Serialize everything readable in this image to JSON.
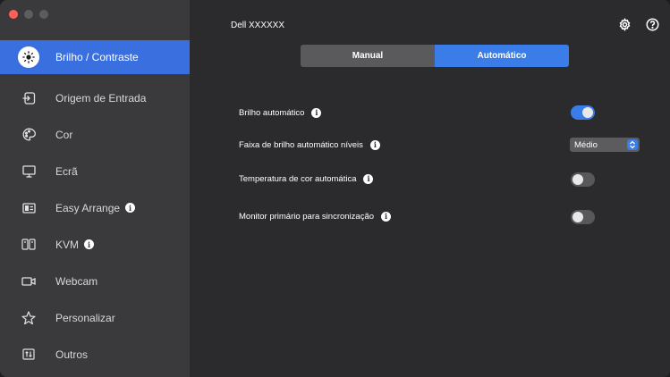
{
  "window": {
    "monitor_name": "Dell XXXXXX"
  },
  "sidebar": {
    "items": [
      {
        "label": "Brilho / Contraste",
        "icon": "brightness-icon",
        "active": true
      },
      {
        "label": "Origem de Entrada",
        "icon": "input-source-icon"
      },
      {
        "label": "Cor",
        "icon": "color-icon"
      },
      {
        "label": "Ecrã",
        "icon": "display-icon"
      },
      {
        "label": "Easy Arrange",
        "icon": "easy-arrange-icon",
        "info": true
      },
      {
        "label": "KVM",
        "icon": "kvm-icon",
        "info": true
      },
      {
        "label": "Webcam",
        "icon": "webcam-icon"
      },
      {
        "label": "Personalizar",
        "icon": "star-icon"
      },
      {
        "label": "Outros",
        "icon": "others-icon"
      }
    ]
  },
  "mode_tabs": {
    "manual": "Manual",
    "auto": "Automático",
    "selected": "auto"
  },
  "settings": {
    "auto_brightness": {
      "label": "Brilho automático",
      "enabled": true
    },
    "auto_brightness_levels": {
      "label": "Faixa de brilho automático níveis",
      "value": "Médio"
    },
    "auto_color_temp": {
      "label": "Temperatura de cor automática",
      "enabled": false
    },
    "primary_monitor_sync": {
      "label": "Monitor primário para sincronização",
      "enabled": false
    }
  },
  "colors": {
    "accent": "#3a7de8",
    "sidebar_active": "#3a6fe0",
    "sidebar_bg": "#3a3a3c",
    "main_bg": "#2b2b2d"
  }
}
